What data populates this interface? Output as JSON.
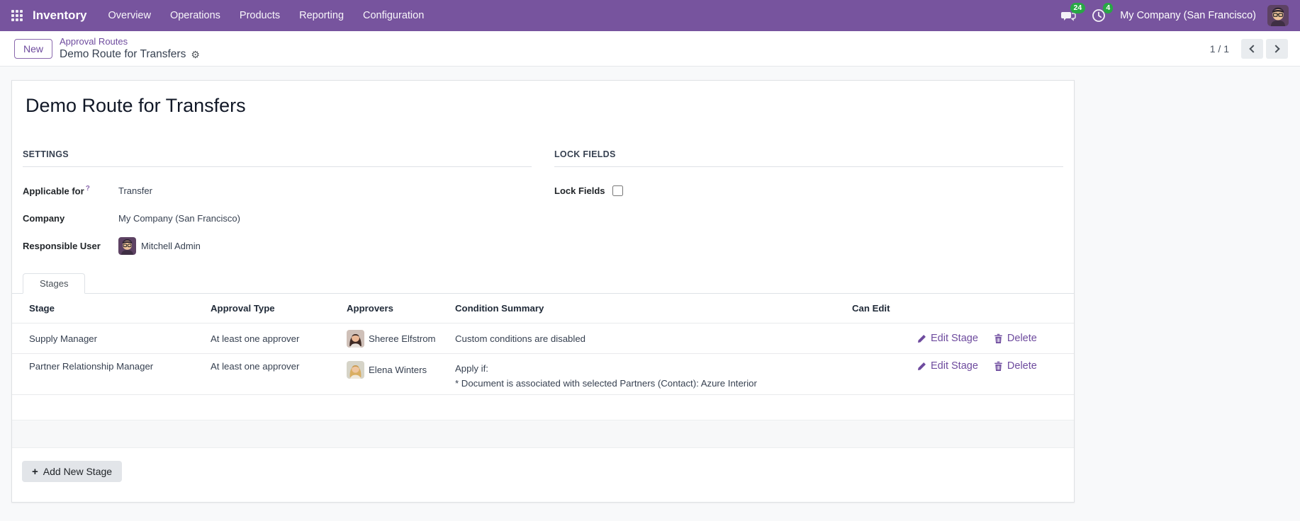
{
  "navbar": {
    "app_name": "Inventory",
    "menu_items": [
      "Overview",
      "Operations",
      "Products",
      "Reporting",
      "Configuration"
    ],
    "messages_count": "24",
    "activities_count": "4",
    "company": "My Company (San Francisco)",
    "colors": {
      "navbar_bg": "#77549E",
      "accent": "#6E4B9E",
      "badge_green": "#28a745"
    }
  },
  "breadcrumb": {
    "new_button": "New",
    "parent": "Approval Routes",
    "current": "Demo Route for Transfers",
    "gear_icon": "⚙",
    "pager_text": "1 / 1"
  },
  "form": {
    "title": "Demo Route for Transfers",
    "settings": {
      "heading": "SETTINGS",
      "applicable_for_label": "Applicable for",
      "applicable_for_help": "?",
      "applicable_for_value": "Transfer",
      "company_label": "Company",
      "company_value": "My Company (San Francisco)",
      "responsible_label": "Responsible User",
      "responsible_value": "Mitchell Admin"
    },
    "lock_fields": {
      "heading": "LOCK FIELDS",
      "label": "Lock Fields",
      "checked": false
    },
    "tab_label": "Stages",
    "stages_table": {
      "columns": [
        "Stage",
        "Approval Type",
        "Approvers",
        "Condition Summary",
        "Can Edit"
      ],
      "rows": [
        {
          "stage": "Supply Manager",
          "approval_type": "At least one approver",
          "approver": "Sheree Elfstrom",
          "condition": [
            "Custom conditions are disabled"
          ],
          "actions": [
            "Edit Stage",
            "Delete"
          ]
        },
        {
          "stage": "Partner Relationship Manager",
          "approval_type": "At least one approver",
          "approver": "Elena Winters",
          "condition": [
            "Apply if:",
            "* Document is associated with selected Partners (Contact): Azure Interior"
          ],
          "actions": [
            "Edit Stage",
            "Delete"
          ]
        }
      ],
      "add_button": "Add New Stage",
      "add_button_icon": "+"
    }
  }
}
